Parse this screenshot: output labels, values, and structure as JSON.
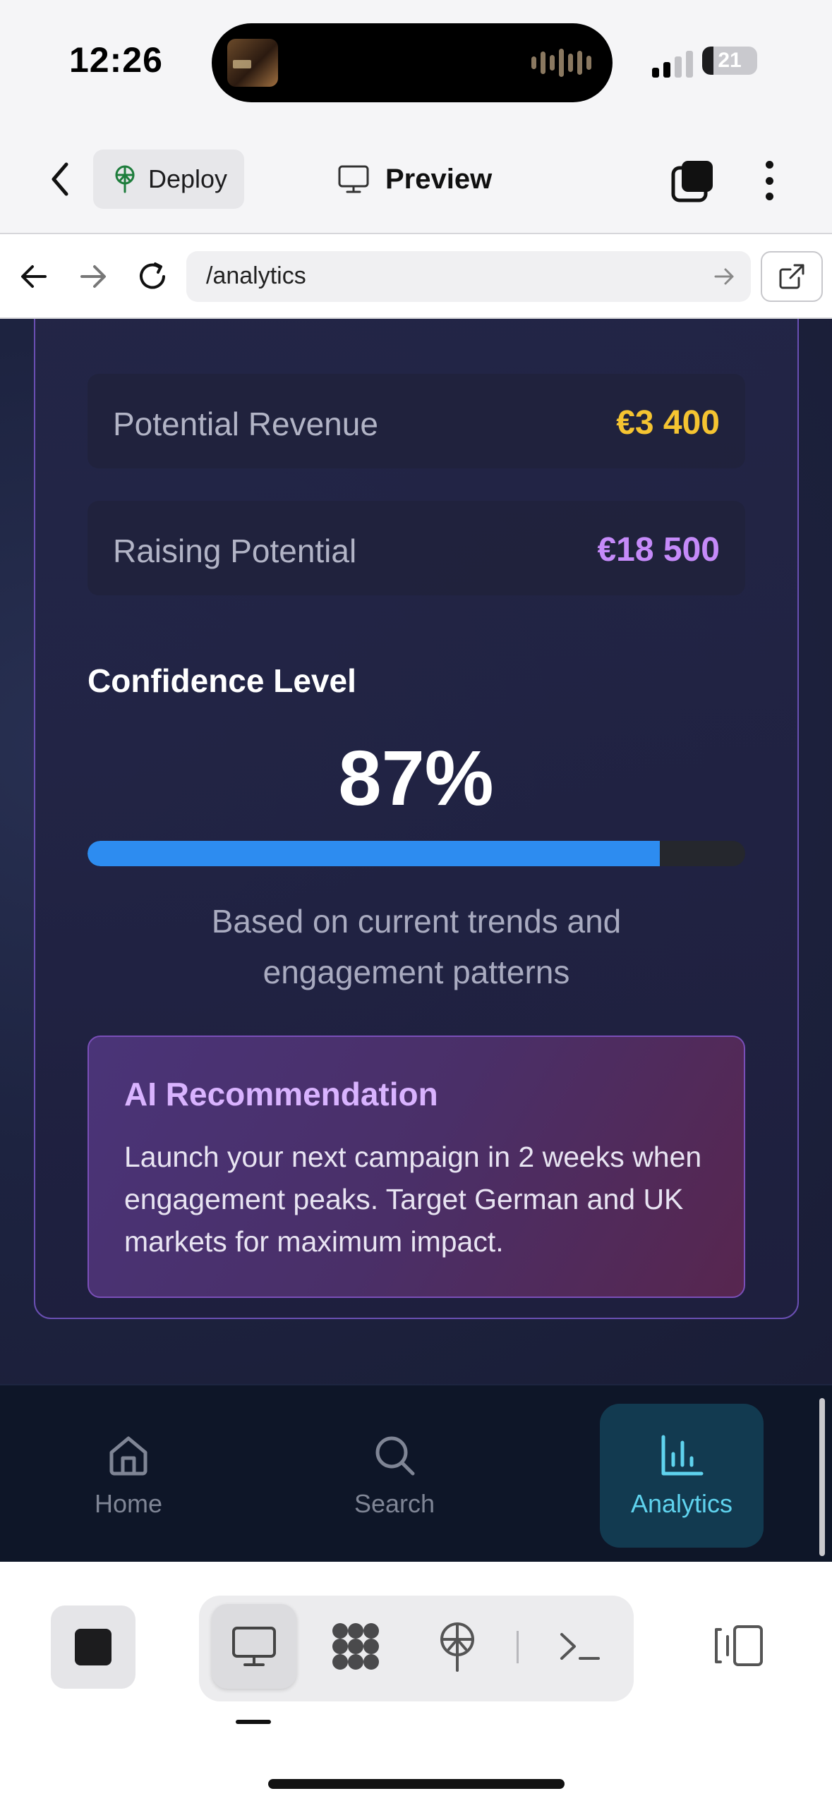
{
  "status_bar": {
    "time": "12:26",
    "battery": "21",
    "battery_level": 0.21,
    "signal_bars_active": 2,
    "signal_bars_total": 4
  },
  "app_bar": {
    "deploy_label": "Deploy",
    "preview_label": "Preview"
  },
  "browser": {
    "url": "/analytics"
  },
  "metrics": [
    {
      "label": "Potential Revenue",
      "value": "€3 400",
      "color": "#f5c431"
    },
    {
      "label": "Raising Potential",
      "value": "€18 500",
      "color": "#c58af9"
    }
  ],
  "confidence": {
    "title": "Confidence Level",
    "value": "87%",
    "progress": 0.87,
    "note": "Based on current trends and engagement patterns"
  },
  "recommendation": {
    "title": "AI Recommendation",
    "body": "Launch your next campaign in 2 weeks when engagement peaks. Target German and UK markets for maximum impact."
  },
  "bottom_nav": {
    "tabs": [
      {
        "label": "Home",
        "icon": "home-icon",
        "active": false
      },
      {
        "label": "Search",
        "icon": "search-icon",
        "active": false
      },
      {
        "label": "Analytics",
        "icon": "analytics-icon",
        "active": true
      }
    ]
  },
  "colors": {
    "accent_blue": "#2d8cf0",
    "active_tab_text": "#5fd3ee",
    "inactive_tab_text": "#7f8595",
    "card_border": "#6a4fb3"
  },
  "editor_toolbar": {
    "icons": [
      "stop-icon",
      "desktop-preview-icon",
      "integrations-icon",
      "deploy-icon",
      "terminal-icon",
      "layout-toggle-icon"
    ]
  }
}
